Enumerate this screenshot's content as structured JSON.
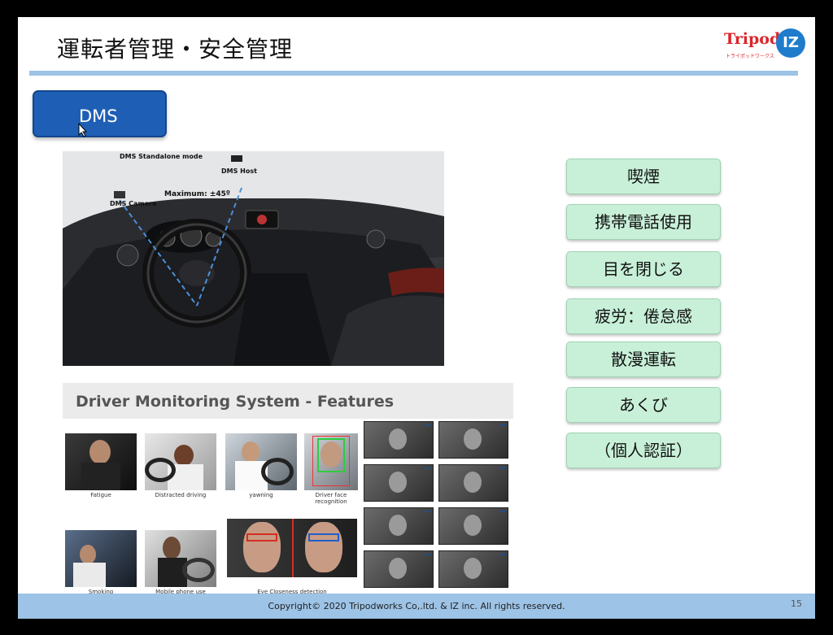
{
  "slide": {
    "title": "運転者管理・安全管理",
    "page_number": "15",
    "copyright": "Copyright©  2020 Tripodworks Co,.ltd. & IZ inc.  All rights reserved."
  },
  "logo": {
    "tripod": "Tripod",
    "tripod_sub": "トライポッドワークス",
    "iz": "IZ"
  },
  "dms_button": {
    "label": "DMS"
  },
  "car_image": {
    "standalone": "DMS Standalone mode",
    "host": "DMS Host",
    "camera": "DMS Camera",
    "maximum": "Maximum: ±45º"
  },
  "features": {
    "heading": "Driver Monitoring System - Features",
    "captions": [
      "Fatigue",
      "Distracted driving",
      "yawning",
      "Driver face recognition",
      "Smoking",
      "Mobile phone use",
      "Eye Closeness detection"
    ]
  },
  "right_buttons": [
    "喫煙",
    "携帯電話使用",
    "目を閉じる",
    "疲労：倦怠感",
    "散漫運転",
    "あくび",
    "（個人認証）"
  ],
  "colors": {
    "accent_bar": "#9dc3e6",
    "dms_button": "#1e5fb5",
    "feature_button": "#c8f0d8",
    "brand_red": "#d9262c",
    "brand_blue": "#1f7ccb"
  }
}
